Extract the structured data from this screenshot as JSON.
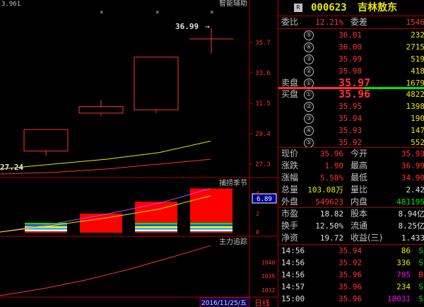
{
  "corner_value": "3.961",
  "main_chart": {
    "indicator_name": "智能辅助",
    "price_marker": "36.99",
    "price_ticks": [
      "35.7",
      "33.6",
      "31.5",
      "29.4",
      "27.3"
    ],
    "ma_label": "27.24",
    "candles": [
      {
        "open": 28.3,
        "close": 29.6,
        "high": 29.6,
        "low": 28.0
      },
      {
        "open": 31.0,
        "close": 30.6,
        "high": 31.4,
        "low": 30.4
      },
      {
        "open": 30.8,
        "close": 34.0,
        "high": 34.0,
        "low": 30.6
      }
    ],
    "ma_yellow": [
      27.2,
      27.5,
      27.8,
      28.2,
      28.9
    ],
    "ma_red": [
      26.9,
      27.0,
      27.2,
      27.5,
      27.8
    ],
    "price_min": 26.9,
    "price_max": 37.3
  },
  "sub_chart1": {
    "name": "捕捞季节",
    "value_badge": "6.89",
    "ticks": [
      "4",
      "2",
      "0"
    ],
    "bars": [
      1.2,
      2.6,
      4.2,
      6.0
    ],
    "line_yellow": [
      0.1,
      1.0,
      2.0,
      3.2,
      5.0
    ],
    "line_purple": [
      0.1,
      1.2,
      2.5,
      4.0,
      6.0
    ],
    "ymax": 7.0
  },
  "sub_chart2": {
    "name": "主力追踪",
    "ticks": [
      "1040",
      "1036",
      "1032"
    ],
    "line": [
      1029.0,
      1031.0,
      1033.5,
      1036.5,
      1040.0,
      1043.5
    ],
    "ymin": 1029.0,
    "ymax": 1045.0
  },
  "status": {
    "date": "2016/11/25/五",
    "period": "日线"
  },
  "quote": {
    "badge": "R",
    "code": "000623",
    "name": "吉林敖东",
    "weibi_label": "委比",
    "weibi": "12.21%",
    "weicha_label": "委差",
    "weicha": "1546",
    "sell_label": "卖盘",
    "buy_label": "买盘",
    "sell": [
      {
        "level": "⑤",
        "price": "36.01",
        "vol": "232"
      },
      {
        "level": "④",
        "price": "36.00",
        "vol": "2715"
      },
      {
        "level": "③",
        "price": "35.99",
        "vol": "519"
      },
      {
        "level": "②",
        "price": "35.98",
        "vol": "418"
      },
      {
        "level": "①",
        "price": "35.97",
        "vol": "1679"
      }
    ],
    "buy": [
      {
        "level": "①",
        "price": "35.96",
        "vol": "4822"
      },
      {
        "level": "②",
        "price": "35.95",
        "vol": "1398"
      },
      {
        "level": "③",
        "price": "35.94",
        "vol": "190"
      },
      {
        "level": "④",
        "price": "35.93",
        "vol": "147"
      },
      {
        "level": "⑤",
        "price": "35.92",
        "vol": "552"
      }
    ],
    "stats": [
      {
        "l1": "现价",
        "v1": "35.96",
        "c1": "red",
        "l2": "今开",
        "v2": "35.93",
        "c2": "red"
      },
      {
        "l1": "涨跌",
        "v1": "1.90",
        "c1": "red",
        "l2": "最高",
        "v2": "36.99",
        "c2": "red"
      },
      {
        "l1": "涨幅",
        "v1": "5.58%",
        "c1": "red",
        "l2": "最低",
        "v2": "34.90",
        "c2": "red"
      },
      {
        "l1": "总量",
        "v1": "103.08万",
        "c1": "yellow",
        "l2": "量比",
        "v2": "2.42",
        "c2": "white"
      },
      {
        "l1": "外盘",
        "v1": "549623",
        "c1": "red",
        "l2": "内盘",
        "v2": "481195",
        "c2": "green"
      }
    ],
    "fund": [
      {
        "l1": "市盈",
        "v1": "18.82",
        "l2": "股本",
        "v2": "8.94亿"
      },
      {
        "l1": "换手",
        "v1": "12.50%",
        "l2": "流通",
        "v2": "8.25亿"
      },
      {
        "l1": "净资",
        "v1": "19.72",
        "l2": "收益(三)",
        "v2": "1.433"
      }
    ],
    "ticks": [
      {
        "time": "14:56",
        "price": "35.94",
        "vol": "86",
        "side": "S",
        "c": "green",
        "vc": "yellow"
      },
      {
        "time": "14:56",
        "price": "35.92",
        "vol": "336",
        "side": "S",
        "c": "green",
        "vc": "yellow"
      },
      {
        "time": "14:56",
        "price": "35.96",
        "vol": "795",
        "side": "B",
        "c": "red",
        "vc": "magenta"
      },
      {
        "time": "14:57",
        "price": "35.96",
        "vol": "234",
        "side": "S",
        "c": "green",
        "vc": "yellow"
      },
      {
        "time": "15:00",
        "price": "35.96",
        "vol": "18031",
        "side": "S",
        "c": "green",
        "vc": "magenta"
      }
    ]
  },
  "colors": {
    "up": "#ff3232",
    "down": "#00e600",
    "grid": "#aa0000",
    "ma": "#e8e800",
    "purple": "#c040ff"
  }
}
